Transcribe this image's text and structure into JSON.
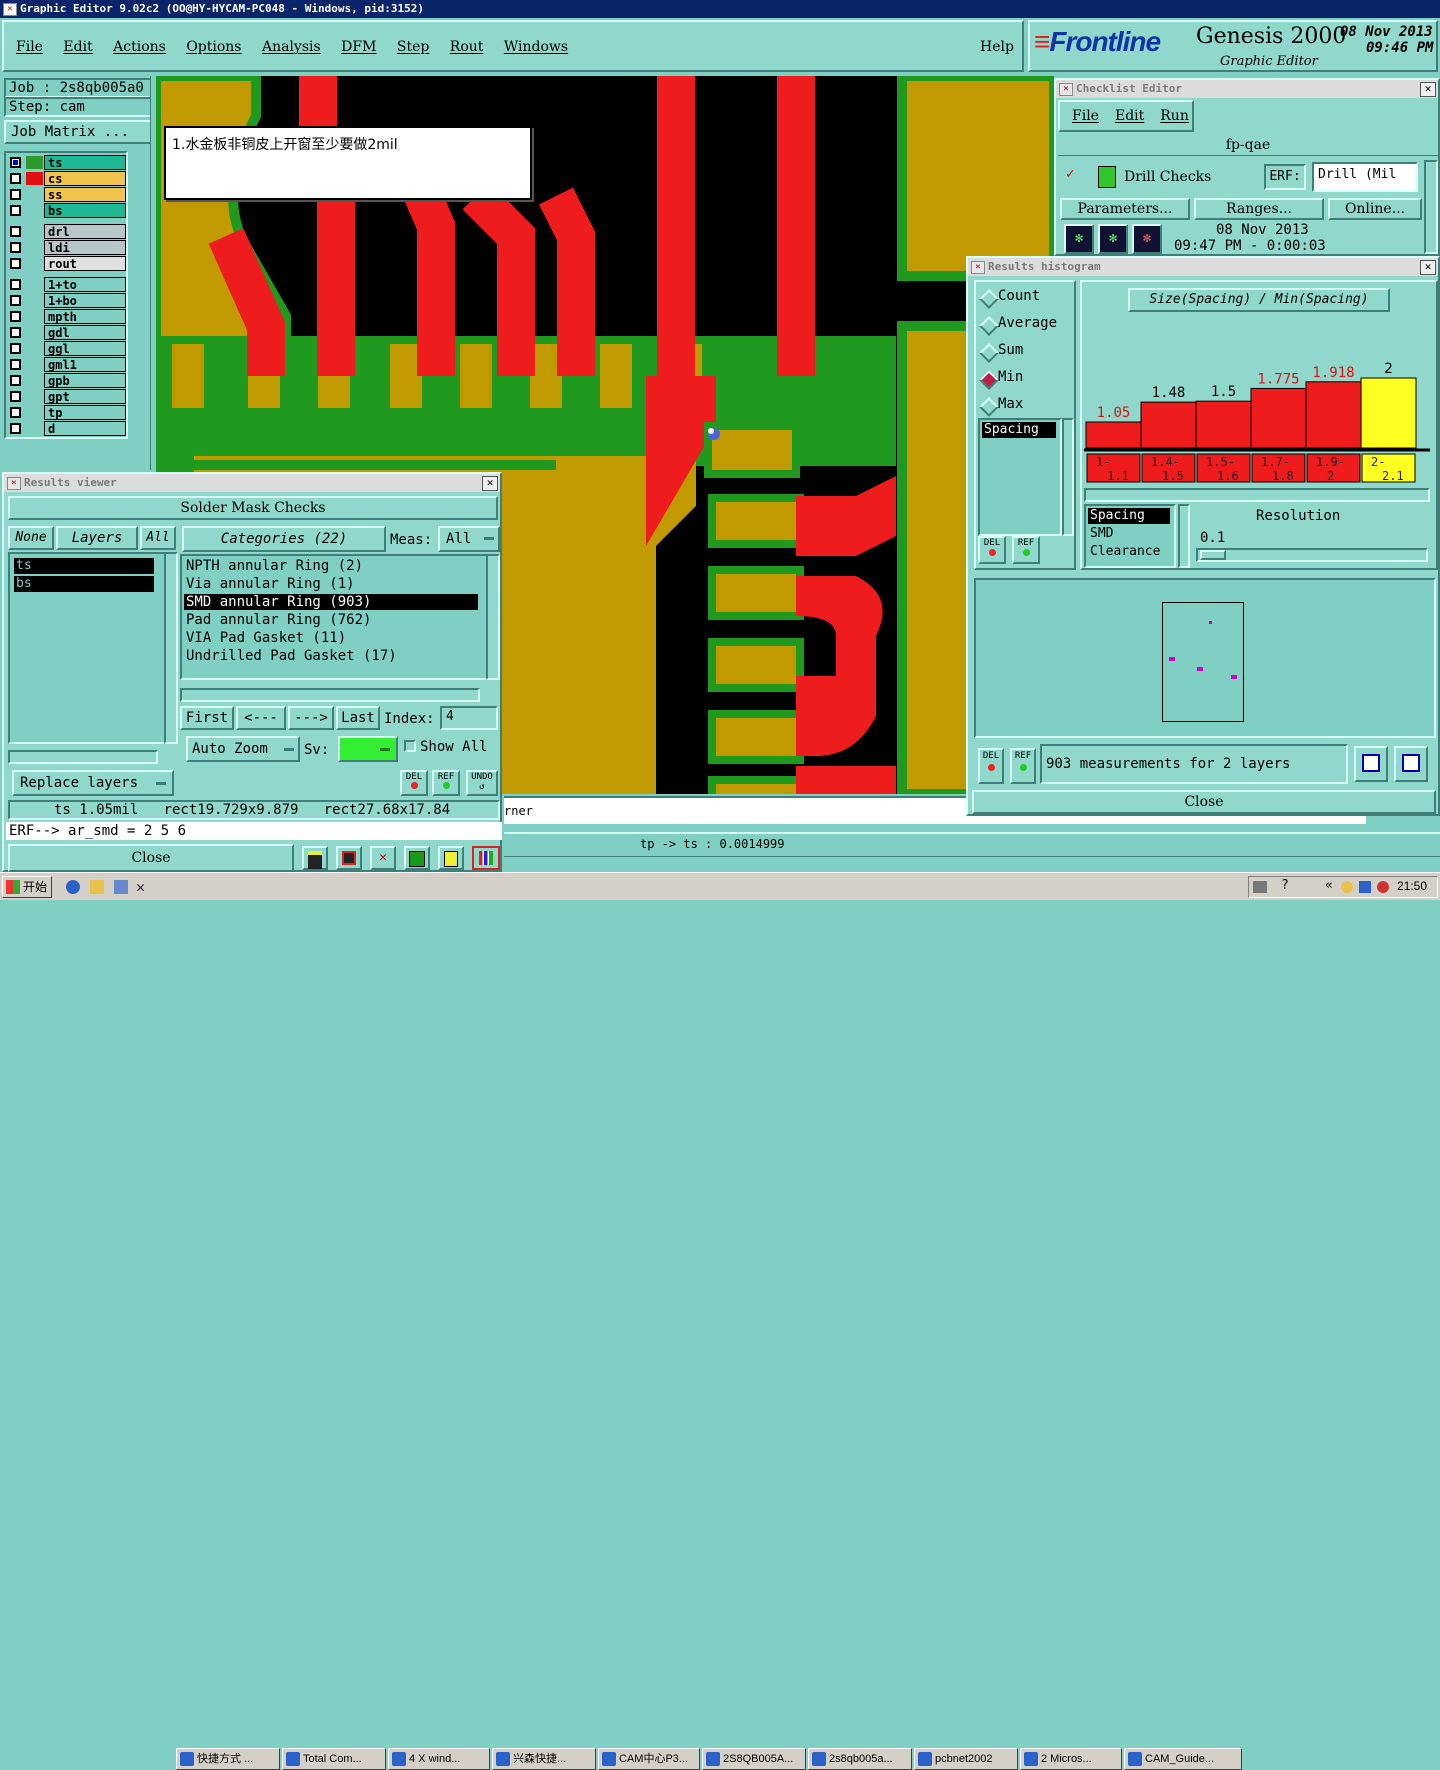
{
  "window_title": "Graphic Editor 9.02c2 (OO@HY-HYCAM-PC048 - Windows, pid:3152)",
  "menu": [
    "File",
    "Edit",
    "Actions",
    "Options",
    "Analysis",
    "DFM",
    "Step",
    "Rout",
    "Windows"
  ],
  "help": "Help",
  "brand": {
    "logo": "Frontline",
    "product": "Genesis 2000",
    "subtitle": "Graphic Editor",
    "date": "08 Nov 2013",
    "time": "09:46 PM"
  },
  "job": {
    "job_label": "Job : 2s8qb005a0",
    "step_label": "Step: cam",
    "job_matrix": "Job Matrix ..."
  },
  "layers": [
    {
      "name": "ts",
      "color": "#1fb894",
      "active": true,
      "swatch": "#2e9a2e"
    },
    {
      "name": "cs",
      "color": "#f2c44e",
      "swatch": "#e01010"
    },
    {
      "name": "ss",
      "color": "#f2c44e",
      "swatch": ""
    },
    {
      "name": "bs",
      "color": "#1fb894",
      "swatch": ""
    },
    {
      "name": "drl",
      "color": "#b7c7c7",
      "swatch": ""
    },
    {
      "name": "ldi",
      "color": "#b7c7c7",
      "swatch": ""
    },
    {
      "name": "rout",
      "color": "#e0e0e0",
      "swatch": ""
    },
    {
      "name": "1+to",
      "color": "#7fcfc3",
      "swatch": ""
    },
    {
      "name": "1+bo",
      "color": "#7fcfc3",
      "swatch": ""
    },
    {
      "name": "mpth",
      "color": "#7fcfc3",
      "swatch": ""
    },
    {
      "name": "gdl",
      "color": "#7fcfc3",
      "swatch": ""
    },
    {
      "name": "ggl",
      "color": "#7fcfc3",
      "swatch": ""
    },
    {
      "name": "gml1",
      "color": "#7fcfc3",
      "swatch": ""
    },
    {
      "name": "gpb",
      "color": "#7fcfc3",
      "swatch": ""
    },
    {
      "name": "gpt",
      "color": "#7fcfc3",
      "swatch": ""
    },
    {
      "name": "tp",
      "color": "#7fcfc3",
      "swatch": ""
    },
    {
      "name": "d",
      "color": "#7fcfc3",
      "swatch": ""
    }
  ],
  "note": "1.水金板非铜皮上开窗至少要做2mil",
  "results_viewer": {
    "title": "Results viewer",
    "header": "Solder Mask Checks",
    "none": "None",
    "layers": "Layers",
    "all": "All",
    "layer_list": [
      "ts",
      "bs"
    ],
    "categories": "Categories (22)",
    "meas_label": "Meas:",
    "meas_value": "All",
    "items": [
      "NPTH annular Ring (2)",
      "Via annular Ring (1)",
      "SMD annular Ring (903)",
      "Pad annular Ring (762)",
      "VIA Pad Gasket (11)",
      "Undrilled Pad Gasket (17)"
    ],
    "selected_index": 2,
    "nav": [
      "First",
      "<---",
      "--->",
      "Last"
    ],
    "index_label": "Index:",
    "index_value": "4",
    "auto_zoom": "Auto Zoom",
    "sv": "Sv:",
    "show_all": "Show All",
    "replace_layers": "Replace layers",
    "del": "DEL",
    "ref": "REF",
    "undo": "UNDO",
    "status": "ts 1.05mil   rect19.729x9.879   rect27.68x17.84",
    "erf": "ERF--> ar_smd = 2 5 6",
    "close": "Close"
  },
  "checklist": {
    "title": "Checklist Editor",
    "menu": [
      "File",
      "Edit",
      "Run"
    ],
    "name": "fp-qae",
    "check": "Drill Checks",
    "erf_label": "ERF:",
    "erf_value": "Drill (Mil",
    "buttons": [
      "Parameters...",
      "Ranges...",
      "Online..."
    ],
    "date": "08 Nov 2013",
    "time": "09:47 PM - 0:00:03"
  },
  "histogram": {
    "title": "Results histogram",
    "options": [
      "Count",
      "Average",
      "Sum",
      "Min",
      "Max"
    ],
    "selected_option": "Min",
    "spacing_box": "Spacing",
    "chart_title": "Size(Spacing) / Min(Spacing)",
    "resolution_label": "Resolution",
    "resolution_value": "0.1",
    "types": [
      "Spacing",
      "SMD",
      "Clearance"
    ],
    "measurements": "903 measurements for 2 layers",
    "close": "Close"
  },
  "chart_data": {
    "type": "bar",
    "title": "Size(Spacing) / Min(Spacing)",
    "categories": [
      "1-1.1",
      "1.4-1.5",
      "1.5-1.6",
      "1.7-1.8",
      "1.9-2",
      "2-2.1"
    ],
    "values": [
      1.05,
      1.48,
      1.5,
      1.775,
      1.918,
      2
    ],
    "value_labels": [
      "1.05",
      "1.48",
      "1.5",
      "1.775",
      "1.918",
      "2"
    ],
    "category_labels": [
      [
        "1-",
        "1.1"
      ],
      [
        "1.4-",
        "1.5"
      ],
      [
        "1.5-",
        "1.6"
      ],
      [
        "1.7-",
        "1.8"
      ],
      [
        "1.9-",
        "2"
      ],
      [
        "2-",
        "2.1"
      ]
    ],
    "colors": [
      "#ee1c1c",
      "#ee1c1c",
      "#ee1c1c",
      "#ee1c1c",
      "#ee1c1c",
      "#ffff22"
    ],
    "ylim": [
      0,
      2
    ]
  },
  "bottom_status": {
    "corner": "rner",
    "measure": "tp -> ts : 0.0014999"
  },
  "taskbar": {
    "start": "开始",
    "items": [
      "快捷方式 ...",
      "Total Com...",
      "4 X wind...",
      "兴森快捷...",
      "CAM中心P3...",
      "2S8QB005A...",
      "2s8qb005a...",
      "pcbnet2002",
      "2 Micros...",
      "CAM_Guide..."
    ],
    "clock": "21:50"
  }
}
